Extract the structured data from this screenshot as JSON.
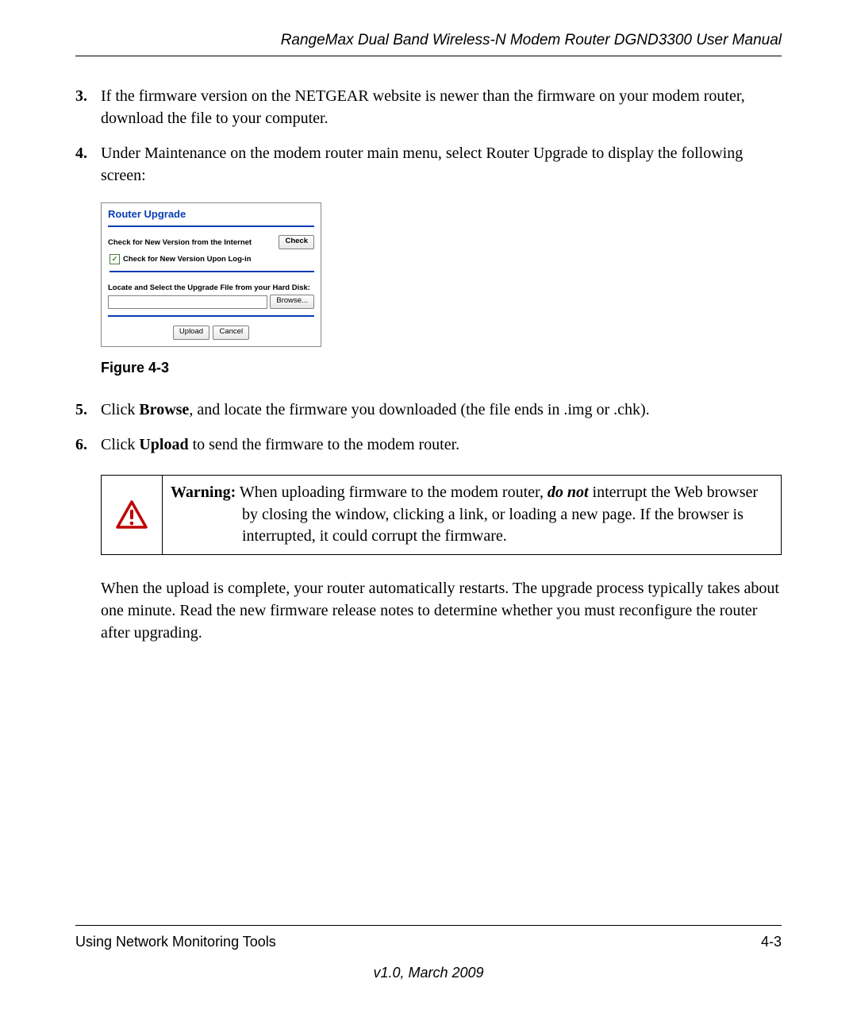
{
  "header": {
    "title": "RangeMax Dual Band Wireless-N Modem Router DGND3300 User Manual"
  },
  "steps": {
    "s3": {
      "num": "3.",
      "text": "If the firmware version on the NETGEAR website is newer than the firmware on your modem router, download the file to your computer."
    },
    "s4": {
      "num": "4.",
      "text": "Under Maintenance on the modem router main menu, select Router Upgrade to display the following screen:"
    },
    "s5": {
      "num": "5.",
      "prefix": "Click ",
      "bold": "Browse",
      "suffix": ", and locate the firmware you downloaded (the file ends in .img or .chk)."
    },
    "s6": {
      "num": "6.",
      "prefix": "Click ",
      "bold": "Upload",
      "suffix": " to send the firmware to the modem router."
    }
  },
  "router_panel": {
    "title": "Router Upgrade",
    "check_label": "Check for New Version from the Internet",
    "check_btn": "Check",
    "auto_check_label": "Check for New Version Upon Log-in",
    "locate_label": "Locate and Select the Upgrade File from your Hard Disk:",
    "browse_btn": "Browse...",
    "upload_btn": "Upload",
    "cancel_btn": "Cancel"
  },
  "figure_caption": "Figure 4-3",
  "warning": {
    "label": "Warning:",
    "text_1": " When uploading firmware to the modem router, ",
    "em": "do not",
    "text_2": " interrupt the Web browser by closing the window, clicking a link, or loading a new page. If the browser is interrupted, it could corrupt the firmware."
  },
  "after_warning": "When the upload is complete, your router automatically restarts. The upgrade process typically takes about one minute. Read the new firmware release notes to determine whether you must reconfigure the router after upgrading.",
  "footer": {
    "section": "Using Network Monitoring Tools",
    "page": "4-3",
    "version": "v1.0, March 2009"
  }
}
